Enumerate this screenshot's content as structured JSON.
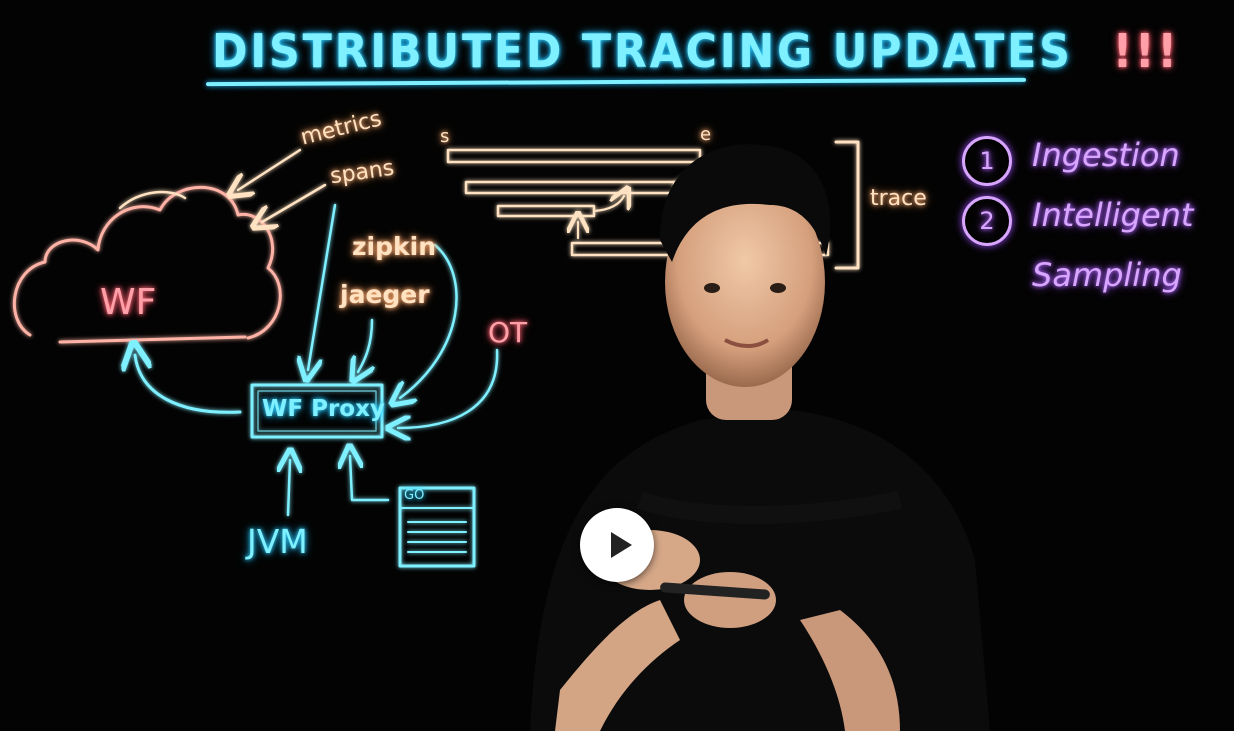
{
  "video": {
    "whiteboard": {
      "title": "DISTRIBUTED TRACING UPDATES",
      "title_suffix": "!!!",
      "cloud_label": "WF",
      "metrics_label": "metrics",
      "spans_label": "spans",
      "zipkin_label": "zipkin",
      "jaeger_label": "jaeger",
      "ot_label": "OT",
      "proxy_label": "WF Proxy",
      "jvm_label": "JVM",
      "code_label": "GO",
      "span_start": "s",
      "span_end": "e",
      "trace_label": "trace",
      "list": [
        {
          "number": "1",
          "text": "Ingestion"
        },
        {
          "number": "2",
          "text": "Intelligent",
          "text_line2": "Sampling"
        }
      ]
    },
    "play_icon": "play-icon",
    "colors": {
      "cyan": "#7ff0ff",
      "peach": "#ffe2c2",
      "pink": "#ff9fa8",
      "violet": "#d9a6ff",
      "background": "#030303"
    }
  }
}
